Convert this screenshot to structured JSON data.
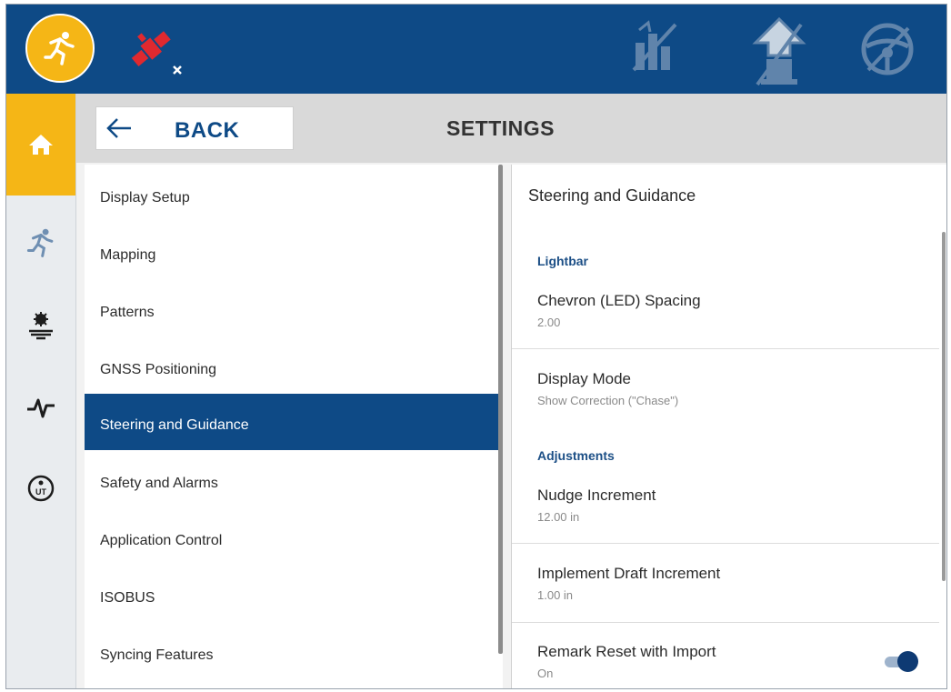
{
  "colors": {
    "brand_blue": "#0e4a86",
    "accent_yellow": "#f5b616"
  },
  "topbar": {
    "left_icons": [
      "run-icon",
      "satellite-disconnected-icon"
    ],
    "right_icons": [
      "field-boundary-off-icon",
      "guidance-vehicle-icon",
      "steering-wheel-off-icon"
    ]
  },
  "leftnav": {
    "items": [
      "home-icon",
      "run-icon",
      "implement-settings-icon",
      "diagnostics-icon",
      "universal-terminal-icon"
    ]
  },
  "header": {
    "back_label": "BACK",
    "title": "SETTINGS"
  },
  "menu": {
    "items": [
      "Display Setup",
      "Mapping",
      "Patterns",
      "GNSS Positioning",
      "Steering and Guidance",
      "Safety and Alarms",
      "Application Control",
      "ISOBUS",
      "Syncing Features"
    ],
    "selected": "Steering and Guidance"
  },
  "panel": {
    "title": "Steering and Guidance",
    "sections": [
      {
        "label": "Lightbar"
      },
      {
        "label": "Adjustments"
      }
    ],
    "settings": [
      {
        "name": "Chevron (LED) Spacing",
        "value": "2.00"
      },
      {
        "name": "Display Mode",
        "value": "Show Correction (\"Chase\")"
      },
      {
        "name": "Nudge Increment",
        "value": "12.00 in"
      },
      {
        "name": "Implement Draft Increment",
        "value": "1.00 in"
      },
      {
        "name": "Remark Reset with Import",
        "value": "On"
      }
    ],
    "remark_reset_toggle_on": true
  }
}
